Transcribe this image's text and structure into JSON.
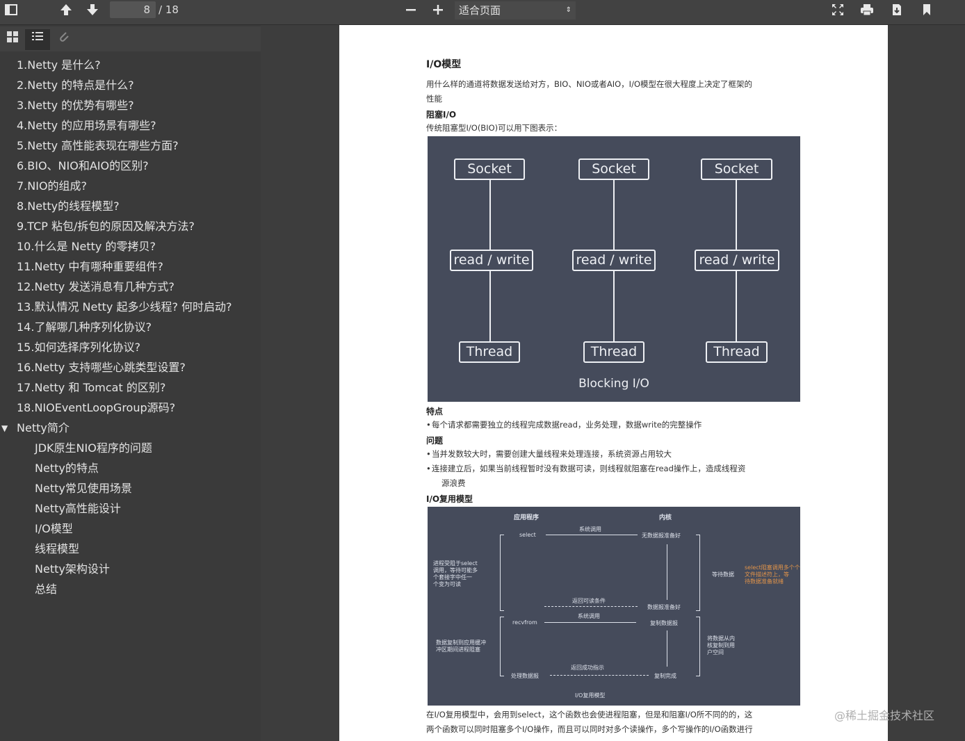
{
  "toolbar": {
    "page_current": "8",
    "page_total": "/ 18",
    "zoom_label": "适合页面",
    "zoom_arrow": "⇕"
  },
  "sidebar": {
    "outline": [
      "1.Netty 是什么?",
      "2.Netty 的特点是什么?",
      "3.Netty 的优势有哪些?",
      "4.Netty 的应用场景有哪些?",
      "5.Netty 高性能表现在哪些方面?",
      "6.BIO、NIO和AIO的区别?",
      "7.NIO的组成?",
      "8.Netty的线程模型?",
      "9.TCP 粘包/拆包的原因及解决方法?",
      "10.什么是 Netty 的零拷贝?",
      "11.Netty 中有哪种重要组件?",
      "12.Netty 发送消息有几种方式?",
      "13.默认情况 Netty 起多少线程? 何时启动?",
      "14.了解哪几种序列化协议?",
      "15.如何选择序列化协议?",
      "16.Netty 支持哪些心跳类型设置?",
      "17.Netty 和 Tomcat 的区别?",
      "18.NIOEventLoopGroup源码?"
    ],
    "section": {
      "label": "Netty简介",
      "toggle": "▼",
      "children": [
        "JDK原生NIO程序的问题",
        "Netty的特点",
        "Netty常见使用场景",
        "Netty高性能设计",
        "I/O模型",
        "线程模型",
        "Netty架构设计",
        "总结"
      ]
    }
  },
  "document": {
    "title": "I/O模型",
    "intro_line1": "用什么样的通道将数据发送给对方，BIO、NIO或者AIO，I/O模型在很大程度上决定了框架的",
    "intro_line2": "性能",
    "blocking_heading": "阻塞I/O",
    "blocking_desc": "传统阻塞型I/O(BIO)可以用下图表示：",
    "diagram1": {
      "socket": "Socket",
      "rw": "read / write",
      "thread": "Thread",
      "caption": "Blocking I/O"
    },
    "features_heading": "特点",
    "features": [
      "每个请求都需要独立的线程完成数据read，业务处理，数据write的完整操作"
    ],
    "problems_heading": "问题",
    "problems": [
      "当并发数较大时，需要创建大量线程来处理连接，系统资源占用较大",
      "连接建立后，如果当前线程暂时没有数据可读，则线程就阻塞在read操作上，造成线程资"
    ],
    "problems_cont": "源浪费",
    "mux_heading": "I/O复用模型",
    "diagram2": {
      "col_app": "应用程序",
      "col_kernel": "内核",
      "select": "select",
      "syscall1": "系统调用",
      "no_data": "无数据报准备好",
      "wait_data": "等待数据",
      "orange_note_1": "select阻塞调用多个个",
      "orange_note_2": "文件描述符上，等",
      "orange_note_3": "待数据准备就绪",
      "left_note_1": "进程受阻于select",
      "left_note_2": "调用，等待可能多",
      "left_note_3": "个套接字中任一",
      "left_note_4": "个变为可读",
      "return_readable": "返回可读条件",
      "data_ready": "数据报准备好",
      "recvfrom": "recvfrom",
      "syscall2": "系统调用",
      "copy_data": "复制数据报",
      "left_note2_1": "数据复制到应用缓冲",
      "left_note2_2": "冲区期间进程阻塞",
      "right_note_1": "将数据从内",
      "right_note_2": "核复制到用",
      "right_note_3": "户空间",
      "return_ok": "返回成功指示",
      "process_data": "处理数据报",
      "copy_done": "复制完成",
      "caption": "I/O复用模型"
    },
    "bottom_line1": "在I/O复用模型中，会用到select，这个函数也会使进程阻塞，但是和阻塞I/O所不同的的，这",
    "bottom_line2": "两个函数可以同时阻塞多个I/O操作，而且可以同时对多个读操作，多个写操作的I/O函数进行"
  },
  "watermark": "@稀土掘金技术社区"
}
